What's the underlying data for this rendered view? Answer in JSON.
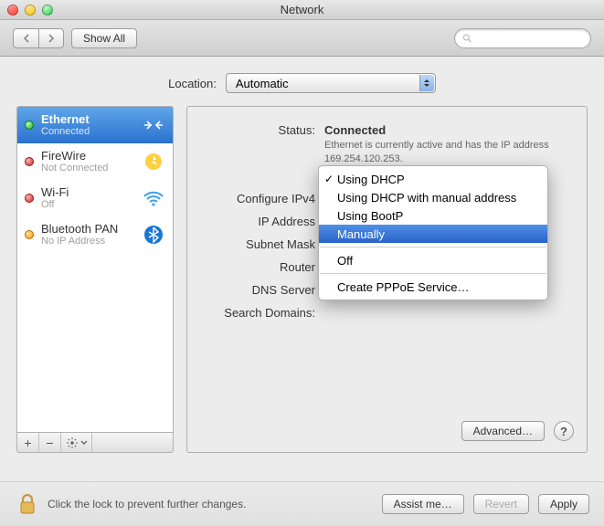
{
  "window": {
    "title": "Network"
  },
  "toolbar": {
    "show_all": "Show All",
    "search_placeholder": ""
  },
  "location": {
    "label": "Location:",
    "value": "Automatic"
  },
  "sidebar": {
    "items": [
      {
        "name": "Ethernet",
        "status": "Connected",
        "dot": "green",
        "selected": true,
        "icon": "ethernet"
      },
      {
        "name": "FireWire",
        "status": "Not Connected",
        "dot": "red",
        "selected": false,
        "icon": "firewire"
      },
      {
        "name": "Wi-Fi",
        "status": "Off",
        "dot": "red",
        "selected": false,
        "icon": "wifi"
      },
      {
        "name": "Bluetooth PAN",
        "status": "No IP Address",
        "dot": "orange",
        "selected": false,
        "icon": "bluetooth"
      }
    ],
    "footer": {
      "add": "+",
      "remove": "−",
      "gear": "✻▾"
    }
  },
  "detail": {
    "status_label": "Status:",
    "status_value": "Connected",
    "status_desc": "Ethernet is currently active and has the IP address 169.254.120.253.",
    "rows": {
      "configure_label": "Configure IPv4",
      "ip_label": "IP Address",
      "subnet_label": "Subnet Mask",
      "router_label": "Router",
      "dns_label": "DNS Server",
      "search_label": "Search Domains:"
    },
    "menu": {
      "items": [
        {
          "label": "Using DHCP",
          "checked": true,
          "highlighted": false,
          "sep": false
        },
        {
          "label": "Using DHCP with manual address",
          "checked": false,
          "highlighted": false,
          "sep": false
        },
        {
          "label": "Using BootP",
          "checked": false,
          "highlighted": false,
          "sep": false
        },
        {
          "label": "Manually",
          "checked": false,
          "highlighted": true,
          "sep": false
        },
        {
          "label": "",
          "checked": false,
          "highlighted": false,
          "sep": true
        },
        {
          "label": "Off",
          "checked": false,
          "highlighted": false,
          "sep": false
        },
        {
          "label": "",
          "checked": false,
          "highlighted": false,
          "sep": true
        },
        {
          "label": "Create PPPoE Service…",
          "checked": false,
          "highlighted": false,
          "sep": false
        }
      ]
    },
    "advanced": "Advanced…",
    "help": "?"
  },
  "footer": {
    "lock_text": "Click the lock to prevent further changes.",
    "assist": "Assist me…",
    "revert": "Revert",
    "apply": "Apply"
  }
}
